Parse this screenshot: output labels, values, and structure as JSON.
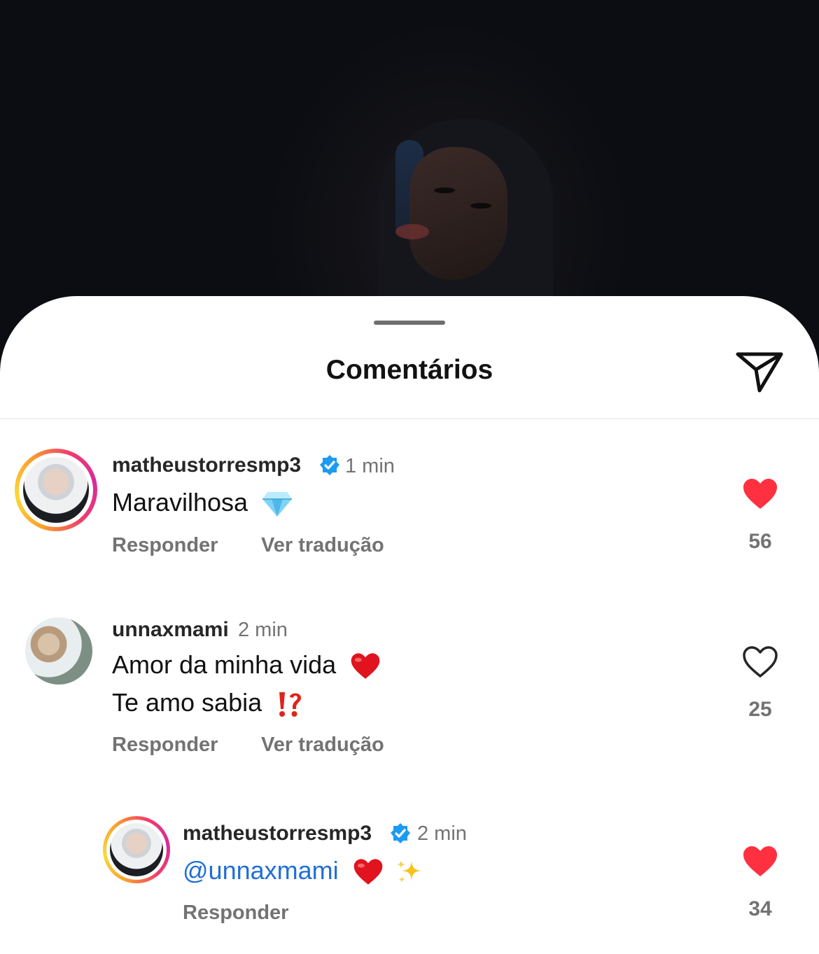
{
  "header": {
    "title": "Comentários"
  },
  "icons": {
    "share": "paper-plane-icon",
    "verified": "verified-badge-icon",
    "like_filled": "heart-filled-icon",
    "like_outline": "heart-outline-icon"
  },
  "colors": {
    "like_red": "#ff3040",
    "verified_blue": "#1d9bf0",
    "mention_blue": "#1f6fd6",
    "muted_text": "#737373"
  },
  "comments": [
    {
      "username": "matheustorresmp3",
      "verified": true,
      "time": "1 min",
      "text": "Maravilhosa",
      "emoji": "gem-icon",
      "reply_label": "Responder",
      "translate_label": "Ver tradução",
      "liked": true,
      "likes": "56"
    },
    {
      "username": "unnaxmami",
      "verified": false,
      "time": "2 min",
      "text_line1": "Amor da minha vida",
      "text_line2": "Te amo sabia",
      "emoji_line1": "red-heart-icon",
      "emoji_line2": "interrobang-icon",
      "reply_label": "Responder",
      "translate_label": "Ver tradução",
      "liked": false,
      "likes": "25"
    },
    {
      "username": "matheustorresmp3",
      "verified": true,
      "time": "2 min",
      "mention": "@unnaxmami",
      "emojis": [
        "red-heart-icon",
        "sparkles-icon"
      ],
      "reply_label": "Responder",
      "liked": true,
      "likes": "34"
    }
  ]
}
